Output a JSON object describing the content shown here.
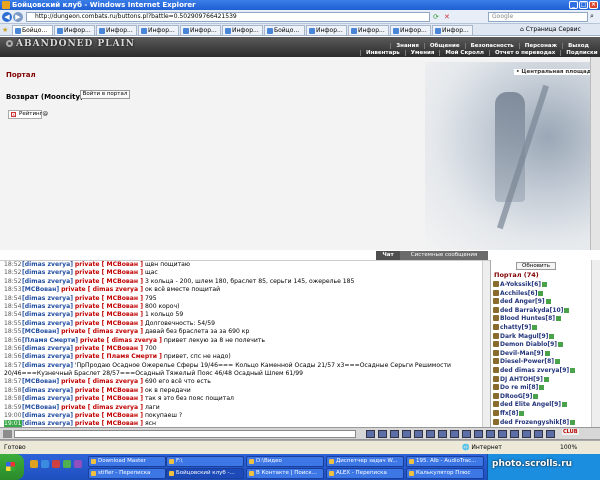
{
  "window": {
    "title": "Бойцовский клуб - Windows Internet Explorer"
  },
  "address": {
    "url": "http://dungeon.combats.ru/buttons.pl?battle=0.502909766421539",
    "search_placeholder": "Google"
  },
  "tabs": [
    {
      "label": "Бойцо...",
      "active": true
    },
    {
      "label": "Инфор..."
    },
    {
      "label": "Инфор..."
    },
    {
      "label": "Инфор..."
    },
    {
      "label": "Инфор..."
    },
    {
      "label": "Инфор..."
    },
    {
      "label": "Бойцо..."
    },
    {
      "label": "Инфор..."
    },
    {
      "label": "Инфор..."
    },
    {
      "label": "Инфор..."
    },
    {
      "label": "Инфор..."
    }
  ],
  "tab_tools": {
    "page": "Страница",
    "tools": "Сервис"
  },
  "game": {
    "logo": "ABANDONED PLAIN",
    "menu_top": [
      "Знания",
      "Общение",
      "Безопасность",
      "Персонаж",
      "Выход"
    ],
    "menu_bottom": [
      "Инвентарь",
      "Умения",
      "Мой Скролл",
      "Отчет о переводах",
      "Подписки",
      "Анкета"
    ]
  },
  "content": {
    "portal_title": "Портал",
    "return_label": "Возврат (Mooncity)",
    "enter_button": "Войти в портал",
    "rating_label": "Рейтинг@",
    "square_link": "• Центральная площадь"
  },
  "chat_tabs": {
    "chat": "Чат",
    "system": "Системные сообщения"
  },
  "chat": [
    {
      "time": "18:52",
      "sender": "[dimas zverya]",
      "tag": "private [ MCBован ]",
      "text": "щвн пощитаю"
    },
    {
      "time": "18:52",
      "sender": "[dimas zverya]",
      "tag": "private [ MCBован ]",
      "text": "щас"
    },
    {
      "time": "18:52",
      "sender": "[dimas zverya]",
      "tag": "private [ MCBован ]",
      "text": "3 кольца - 200, шлем 180, браслет 85, серьги 145, ожерелье 185"
    },
    {
      "time": "18:53",
      "sender": "[MCBован]",
      "tag": "private [ dimas zverya ]",
      "text": "ок всё вместе пощитай"
    },
    {
      "time": "18:54",
      "sender": "[dimas zverya]",
      "tag": "private [ MCBован ]",
      "text": "795"
    },
    {
      "time": "18:54",
      "sender": "[dimas zverya]",
      "tag": "private [ MCBован ]",
      "text": "800 короч)"
    },
    {
      "time": "18:54",
      "sender": "[dimas zverya]",
      "tag": "private [ MCBован ]",
      "text": "1 кольцо 59"
    },
    {
      "time": "18:55",
      "sender": "[dimas zverya]",
      "tag": "private [ MCBован ]",
      "text": "Долговечность: 54/59"
    },
    {
      "time": "18:55",
      "sender": "[MCBован]",
      "tag": "private [ dimas zverya ]",
      "text": "давай без браслета за за 690 кр"
    },
    {
      "time": "18:56",
      "sender": "[Пламя Смерти]",
      "tag": "private [ dimas zverya ]",
      "text": "привет лекую за 8 не полечить"
    },
    {
      "time": "18:56",
      "sender": "[dimas zverya]",
      "tag": "private [ MCBован ]",
      "text": "700"
    },
    {
      "time": "18:56",
      "sender": "[dimas zverya]",
      "tag": "private [ Пламя Смерти ]",
      "text": "привет, спс не надо)"
    },
    {
      "time": "18:57",
      "sender": "[dimas zverya]",
      "tag": "",
      "text": "'ПрПродаю Осадное Ожерелье Сферы 19/46=== Кольцо Каменной Осады 21/57 х3===Осадные Серьги Решимости"
    },
    {
      "time": "",
      "sender": "",
      "tag": "",
      "text": "20/46===Кузнечный Браслет 28/57===Осадный Тяжелый Пояс 46/48 Осадный Шлем 61/99"
    },
    {
      "time": "18:57",
      "sender": "[MCBован]",
      "tag": "private [ dimas zverya ]",
      "text": "690 его всё что есть"
    },
    {
      "time": "18:58",
      "sender": "[dimas zverya]",
      "tag": "private [ MCBован ]",
      "text": "ок в передачи"
    },
    {
      "time": "18:58",
      "sender": "[dimas zverya]",
      "tag": "private [ MCBован ]",
      "text": "так я это без пояс пощитал"
    },
    {
      "time": "18:59",
      "sender": "[MCBован]",
      "tag": "private [ dimas zverya ]",
      "text": "лаги"
    },
    {
      "time": "19:00",
      "sender": "[dimas zverya]",
      "tag": "private [ MCBован ]",
      "text": "покупаеш ?"
    },
    {
      "time": "19:01",
      "sender": "[dimas zverya]",
      "tag": "private [ MCBован ]",
      "text": "ясн"
    },
    {
      "time": "19:03",
      "sender": "",
      "tag": "",
      "text": "Сделка между \"dimas zverya\" и \"MCBован\" состоялась",
      "system": "Внимание!"
    }
  ],
  "users": {
    "refresh": "Обновить",
    "header": "Портал (74)",
    "list": [
      "A-Yokssik[6]",
      "Acchiles[6]",
      "ded Anger[9]",
      "ded Barrakyda[10]",
      "Blood Huntes[8]",
      "chatty[9]",
      "Dark Magul[9]",
      "Demon Diablo[9]",
      "Devil-Man[9]",
      "Diesel-Power[8]",
      "ded dimas zverya[9]",
      "DJ AHTOH[9]",
      "Do re mi[8]",
      "DRooG[9]",
      "ded Elite Angel[9]",
      "ffx[8]",
      "ded Frozengyshik[8]"
    ]
  },
  "status": {
    "ready": "Готово",
    "zone": "Интернет",
    "zoom": "100%"
  },
  "taskbar": {
    "tasks": [
      {
        "label": "Download Master"
      },
      {
        "label": "F:\\"
      },
      {
        "label": "D:\\Видео"
      },
      {
        "label": "Диспетчер задач W..."
      },
      {
        "label": "195. Alb - AudioTrac..."
      },
      {
        "label": "stifler - Переписка"
      },
      {
        "label": "Бойцовский клуб -...",
        "active": true
      },
      {
        "label": "В Контакте | Поиск..."
      },
      {
        "label": "ALEX - Переписка"
      },
      {
        "label": "Калькулятор Плюс"
      }
    ],
    "watermark": "photo.scrolls.ru"
  },
  "colors": {
    "accent_private": "#c00000",
    "name_blue": "#224ea0",
    "time_highlight": "#3aa84a",
    "portal_title": "#800000"
  }
}
